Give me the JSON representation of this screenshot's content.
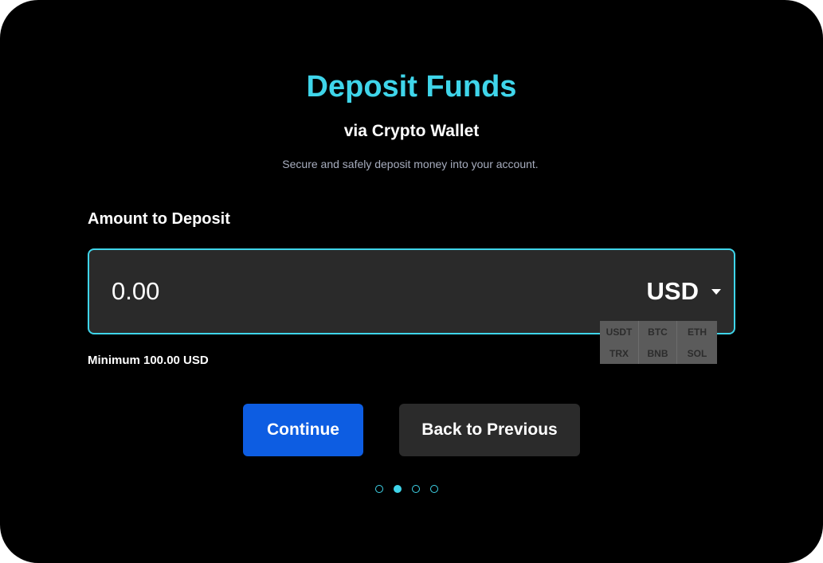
{
  "header": {
    "title": "Deposit Funds",
    "subtitle": "via Crypto Wallet",
    "caption": "Secure and safely deposit money into your account."
  },
  "form": {
    "amount_label": "Amount to Deposit",
    "amount_value": "0.00",
    "currency_selected": "USD",
    "currency_options": [
      "USDT",
      "BTC",
      "ETH",
      "TRX",
      "BNB",
      "SOL"
    ],
    "minimum_text": "Minimum 100.00 USD"
  },
  "actions": {
    "continue_label": "Continue",
    "back_label": "Back to Previous"
  },
  "pager": {
    "total_steps": 4,
    "current_step": 2
  },
  "colors": {
    "accent": "#3fd5ea",
    "primary_button": "#0d5de2",
    "background": "#000000"
  }
}
